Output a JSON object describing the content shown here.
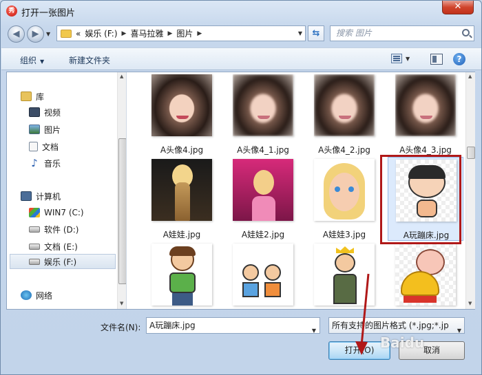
{
  "window": {
    "title": "打开一张图片",
    "app_icon_glyph": "秀"
  },
  "address": {
    "prefix": "«",
    "segments": [
      "娱乐 (F:)",
      "喜马拉雅",
      "图片"
    ]
  },
  "search": {
    "placeholder": "搜索 图片"
  },
  "toolbar": {
    "organize": "组织",
    "new_folder": "新建文件夹"
  },
  "nav": {
    "favorites": "库",
    "library_items": [
      "视频",
      "图片",
      "文档",
      "音乐"
    ],
    "computer": "计算机",
    "drives": [
      "WIN7 (C:)",
      "软件 (D:)",
      "文档 (E:)",
      "娱乐 (F:)"
    ],
    "network": "网络",
    "selected": "娱乐 (F:)"
  },
  "files": [
    {
      "name": "A头像4.jpg",
      "kind": "portrait"
    },
    {
      "name": "A头像4_1.jpg",
      "kind": "portrait-blur"
    },
    {
      "name": "A头像4_2.jpg",
      "kind": "portrait-blur"
    },
    {
      "name": "A头像4_3.jpg",
      "kind": "portrait-blur"
    },
    {
      "name": "A娃娃.jpg",
      "kind": "doll-dark"
    },
    {
      "name": "A娃娃2.jpg",
      "kind": "doll-pink"
    },
    {
      "name": "A娃娃3.jpg",
      "kind": "doll-head"
    },
    {
      "name": "A玩蹦床.jpg",
      "kind": "cartoon-boy"
    },
    {
      "name": "",
      "kind": "cartoon-man"
    },
    {
      "name": "",
      "kind": "cartoon-kids"
    },
    {
      "name": "",
      "kind": "cartoon-king"
    },
    {
      "name": "",
      "kind": "cartoon-pig"
    }
  ],
  "selected_file": "A玩蹦床.jpg",
  "bottom": {
    "filename_label": "文件名(N):",
    "filename_value": "A玩蹦床.jpg",
    "filetype_value": "所有支持的图片格式 (*.jpg;*.jp",
    "open_button": "打开(O)",
    "cancel_button": "取消"
  },
  "watermark": "Baidu"
}
